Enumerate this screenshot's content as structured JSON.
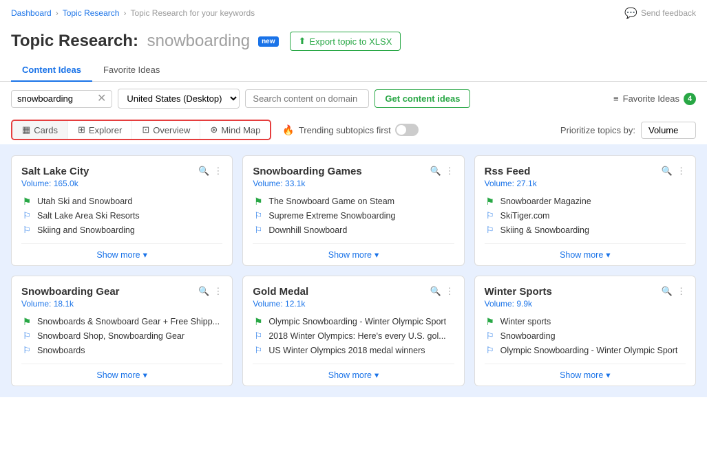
{
  "breadcrumb": {
    "items": [
      "Dashboard",
      "Topic Research",
      "Topic Research for your keywords"
    ]
  },
  "page": {
    "title": "Topic Research:",
    "keyword": "snowboarding",
    "new_badge": "new",
    "export_btn": "Export topic to XLSX",
    "send_feedback": "Send feedback"
  },
  "tabs": {
    "items": [
      "Content Ideas",
      "Favorite Ideas"
    ],
    "active": 0
  },
  "controls": {
    "keyword_value": "snowboarding",
    "country_value": "United States (Desktop)",
    "domain_placeholder": "Search content on domain",
    "get_ideas_label": "Get content ideas",
    "favorite_label": "Favorite Ideas",
    "favorite_count": "4"
  },
  "view_tabs": {
    "items": [
      {
        "label": "Cards",
        "icon": "▦"
      },
      {
        "label": "Explorer",
        "icon": "⊞"
      },
      {
        "label": "Overview",
        "icon": "⊡"
      },
      {
        "label": "Mind Map",
        "icon": "⊛"
      }
    ],
    "active": 0
  },
  "trending": {
    "label": "Trending subtopics first"
  },
  "prioritize": {
    "label": "Prioritize topics by:",
    "value": "Volume"
  },
  "cards": [
    {
      "title": "Salt Lake City",
      "volume": "Volume: 165.0k",
      "items": [
        {
          "text": "Utah Ski and Snowboard",
          "type": "green"
        },
        {
          "text": "Salt Lake Area Ski Resorts",
          "type": "blue"
        },
        {
          "text": "Skiing and Snowboarding",
          "type": "blue"
        }
      ],
      "show_more": "Show more"
    },
    {
      "title": "Snowboarding Games",
      "volume": "Volume: 33.1k",
      "items": [
        {
          "text": "The Snowboard Game on Steam",
          "type": "green"
        },
        {
          "text": "Supreme Extreme Snowboarding",
          "type": "blue"
        },
        {
          "text": "Downhill Snowboard",
          "type": "blue"
        }
      ],
      "show_more": "Show more"
    },
    {
      "title": "Rss Feed",
      "volume": "Volume: 27.1k",
      "items": [
        {
          "text": "Snowboarder Magazine",
          "type": "green"
        },
        {
          "text": "SkiTiger.com",
          "type": "blue"
        },
        {
          "text": "Skiing & Snowboarding",
          "type": "blue"
        }
      ],
      "show_more": "Show more"
    },
    {
      "title": "Snowboarding Gear",
      "volume": "Volume: 18.1k",
      "items": [
        {
          "text": "Snowboards & Snowboard Gear + Free Shipp...",
          "type": "green"
        },
        {
          "text": "Snowboard Shop, Snowboarding Gear",
          "type": "blue"
        },
        {
          "text": "Snowboards",
          "type": "blue"
        }
      ],
      "show_more": "Show more"
    },
    {
      "title": "Gold Medal",
      "volume": "Volume: 12.1k",
      "items": [
        {
          "text": "Olympic Snowboarding - Winter Olympic Sport",
          "type": "green"
        },
        {
          "text": "2018 Winter Olympics: Here's every U.S. gol...",
          "type": "blue"
        },
        {
          "text": "US Winter Olympics 2018 medal winners",
          "type": "blue"
        }
      ],
      "show_more": "Show more"
    },
    {
      "title": "Winter Sports",
      "volume": "Volume: 9.9k",
      "items": [
        {
          "text": "Winter sports",
          "type": "green"
        },
        {
          "text": "Snowboarding",
          "type": "blue"
        },
        {
          "text": "Olympic Snowboarding - Winter Olympic Sport",
          "type": "blue"
        }
      ],
      "show_more": "Show more"
    }
  ]
}
